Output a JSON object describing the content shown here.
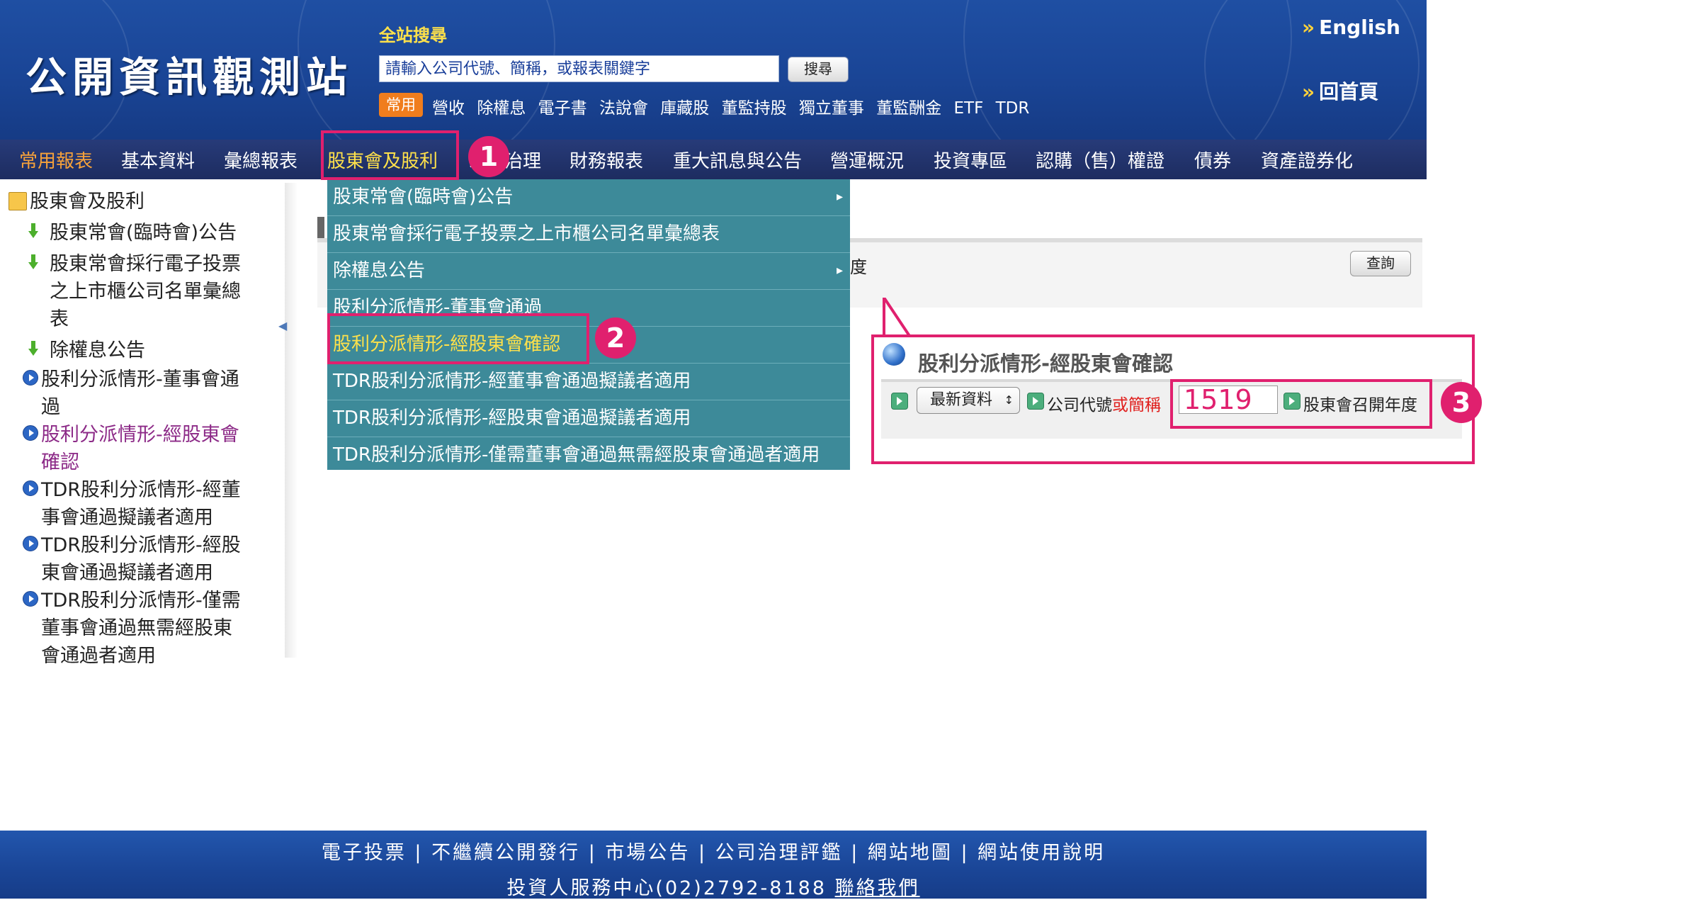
{
  "header": {
    "logo": "公開資訊觀測站",
    "search_title": "全站搜尋",
    "search_placeholder": "請輸入公司代號、簡稱，或報表關鍵字",
    "search_button": "搜尋",
    "quick_badge": "常用",
    "quick_links": [
      "營收",
      "除權息",
      "電子書",
      "法說會",
      "庫藏股",
      "董監持股",
      "獨立董事",
      "董監酬金",
      "ETF",
      "TDR"
    ],
    "english": "English",
    "home": "回首頁"
  },
  "main_nav": [
    "常用報表",
    "基本資料",
    "彙總報表",
    "股東會及股利",
    "公司治理",
    "財務報表",
    "重大訊息與公告",
    "營運概況",
    "投資專區",
    "認購（售）權證",
    "債券",
    "資產證券化"
  ],
  "sidebar": {
    "root": "股東會及股利",
    "items": [
      "股東常會(臨時會)公告",
      "股東常會採行電子投票之上市櫃公司名單彙總表",
      "除權息公告",
      "股利分派情形-董事會通過",
      "股利分派情形-經股東會確認",
      "TDR股利分派情形-經董事會通過擬議者適用",
      "TDR股利分派情形-經股東會通過擬議者適用",
      "TDR股利分派情形-僅需董事會通過無需經股東會通過者適用"
    ]
  },
  "dropdown": [
    "股東常會(臨時會)公告",
    "股東常會採行電子投票之上市櫃公司名單彙總表",
    "除權息公告",
    "股利分派情形-董事會通過",
    "股利分派情形-經股東會確認",
    "TDR股利分派情形-經董事會通過擬議者適用",
    "TDR股利分派情形-經股東會通過擬議者適用",
    "TDR股利分派情形-僅需董事會通過無需經股東會通過者適用"
  ],
  "background_panel": {
    "partial_text": "度",
    "query_button": "查詢"
  },
  "callout": {
    "title": "股利分派情形-經股東會確認",
    "select_value": "最新資料",
    "company_label": "公司代號",
    "company_label_red": "或簡稱",
    "company_value": "1519",
    "meeting_year_label": "股東會召開年度"
  },
  "annotations": [
    "1",
    "2",
    "3"
  ],
  "footer": {
    "links": "電子投票 | 不繼續公開發行 | 市場公告 | 公司治理評鑑 | 網站地圖 | 網站使用說明",
    "contact": "投資人服務中心(02)2792-8188",
    "contact_link": "聯絡我們"
  },
  "colors": {
    "header_blue": "#1a4596",
    "nav_dark": "#1d2c60",
    "dropdown_teal": "#3d8a99",
    "highlight_yellow": "#ffe14a",
    "annotation_pink": "#e0206e",
    "quick_badge_orange": "#f07d1d"
  }
}
